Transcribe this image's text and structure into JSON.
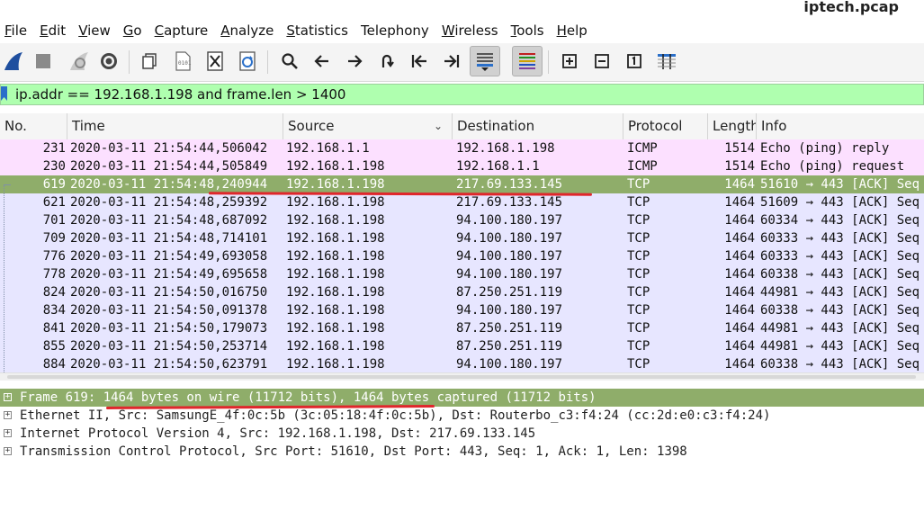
{
  "window": {
    "title": "iptech.pcap"
  },
  "menu": {
    "items": [
      {
        "label": "File",
        "u": "F",
        "rest": "ile"
      },
      {
        "label": "Edit",
        "u": "E",
        "rest": "dit"
      },
      {
        "label": "View",
        "u": "V",
        "rest": "iew"
      },
      {
        "label": "Go",
        "u": "G",
        "rest": "o"
      },
      {
        "label": "Capture",
        "u": "C",
        "rest": "apture"
      },
      {
        "label": "Analyze",
        "u": "A",
        "rest": "nalyze"
      },
      {
        "label": "Statistics",
        "u": "S",
        "rest": "tatistics"
      },
      {
        "label": "Telephony",
        "u": "",
        "rest": "Telephony"
      },
      {
        "label": "Wireless",
        "u": "W",
        "rest": "ireless"
      },
      {
        "label": "Tools",
        "u": "T",
        "rest": "ools"
      },
      {
        "label": "Help",
        "u": "H",
        "rest": "elp"
      }
    ]
  },
  "toolbar": {
    "icons": [
      "shark-fin-icon",
      "stop-icon",
      "restart-fin-icon",
      "gear-icon",
      "open-file-icon",
      "file-icon",
      "close-file-icon",
      "reload-icon",
      "search-icon",
      "arrow-left-icon",
      "arrow-right-icon",
      "go-to-packet-icon",
      "first-packet-icon",
      "last-packet-icon",
      "autoscroll-icon",
      "colorize-icon",
      "zoom-in-icon",
      "zoom-out-icon",
      "zoom-normal-icon",
      "resize-columns-icon"
    ]
  },
  "filter": {
    "value": "ip.addr == 192.168.1.198 and frame.len > 1400"
  },
  "packet_list": {
    "columns": [
      "No.",
      "Time",
      "Source",
      "Destination",
      "Protocol",
      "Length",
      "Info"
    ],
    "rows": [
      {
        "no": "231",
        "time": "2020-03-11 21:54:44,506042",
        "src": "192.168.1.1",
        "dst": "192.168.1.198",
        "proto": "ICMP",
        "len": "1514",
        "info": "Echo (ping) reply",
        "kind": "icmp"
      },
      {
        "no": "230",
        "time": "2020-03-11 21:54:44,505849",
        "src": "192.168.1.198",
        "dst": "192.168.1.1",
        "proto": "ICMP",
        "len": "1514",
        "info": "Echo (ping) request",
        "kind": "icmp"
      },
      {
        "no": "619",
        "time": "2020-03-11 21:54:48,240944",
        "src": "192.168.1.198",
        "dst": "217.69.133.145",
        "proto": "TCP",
        "len": "1464",
        "info": "51610 → 443 [ACK] Seq",
        "kind": "sel"
      },
      {
        "no": "621",
        "time": "2020-03-11 21:54:48,259392",
        "src": "192.168.1.198",
        "dst": "217.69.133.145",
        "proto": "TCP",
        "len": "1464",
        "info": "51609 → 443 [ACK] Seq",
        "kind": "tcp"
      },
      {
        "no": "701",
        "time": "2020-03-11 21:54:48,687092",
        "src": "192.168.1.198",
        "dst": "94.100.180.197",
        "proto": "TCP",
        "len": "1464",
        "info": "60334 → 443 [ACK] Seq",
        "kind": "tcp"
      },
      {
        "no": "709",
        "time": "2020-03-11 21:54:48,714101",
        "src": "192.168.1.198",
        "dst": "94.100.180.197",
        "proto": "TCP",
        "len": "1464",
        "info": "60333 → 443 [ACK] Seq",
        "kind": "tcp"
      },
      {
        "no": "776",
        "time": "2020-03-11 21:54:49,693058",
        "src": "192.168.1.198",
        "dst": "94.100.180.197",
        "proto": "TCP",
        "len": "1464",
        "info": "60333 → 443 [ACK] Seq",
        "kind": "tcp"
      },
      {
        "no": "778",
        "time": "2020-03-11 21:54:49,695658",
        "src": "192.168.1.198",
        "dst": "94.100.180.197",
        "proto": "TCP",
        "len": "1464",
        "info": "60338 → 443 [ACK] Seq",
        "kind": "tcp"
      },
      {
        "no": "824",
        "time": "2020-03-11 21:54:50,016750",
        "src": "192.168.1.198",
        "dst": "87.250.251.119",
        "proto": "TCP",
        "len": "1464",
        "info": "44981 → 443 [ACK] Seq",
        "kind": "tcp"
      },
      {
        "no": "834",
        "time": "2020-03-11 21:54:50,091378",
        "src": "192.168.1.198",
        "dst": "94.100.180.197",
        "proto": "TCP",
        "len": "1464",
        "info": "60338 → 443 [ACK] Seq",
        "kind": "tcp"
      },
      {
        "no": "841",
        "time": "2020-03-11 21:54:50,179073",
        "src": "192.168.1.198",
        "dst": "87.250.251.119",
        "proto": "TCP",
        "len": "1464",
        "info": "44981 → 443 [ACK] Seq",
        "kind": "tcp"
      },
      {
        "no": "855",
        "time": "2020-03-11 21:54:50,253714",
        "src": "192.168.1.198",
        "dst": "87.250.251.119",
        "proto": "TCP",
        "len": "1464",
        "info": "44981 → 443 [ACK] Seq",
        "kind": "tcp"
      },
      {
        "no": "884",
        "time": "2020-03-11 21:54:50,623791",
        "src": "192.168.1.198",
        "dst": "94.100.180.197",
        "proto": "TCP",
        "len": "1464",
        "info": "60338 → 443 [ACK] Seq",
        "kind": "tcp"
      }
    ]
  },
  "details": {
    "rows": [
      {
        "text": "Frame 619: 1464 bytes on wire (11712 bits), 1464 bytes captured (11712 bits)",
        "selected": true
      },
      {
        "text": "Ethernet II, Src: SamsungE_4f:0c:5b (3c:05:18:4f:0c:5b), Dst: Routerbo_c3:f4:24 (cc:2d:e0:c3:f4:24)",
        "selected": false
      },
      {
        "text": "Internet Protocol Version 4, Src: 192.168.1.198, Dst: 217.69.133.145",
        "selected": false
      },
      {
        "text": "Transmission Control Protocol, Src Port: 51610, Dst Port: 443, Seq: 1, Ack: 1, Len: 1398",
        "selected": false
      }
    ]
  },
  "colors": {
    "filter_ok": "#afffaf",
    "selected": "#8fad6a",
    "icmp_row": "#fce0ff",
    "tcp_row": "#e7e6ff",
    "annotation": "#e0262c"
  }
}
